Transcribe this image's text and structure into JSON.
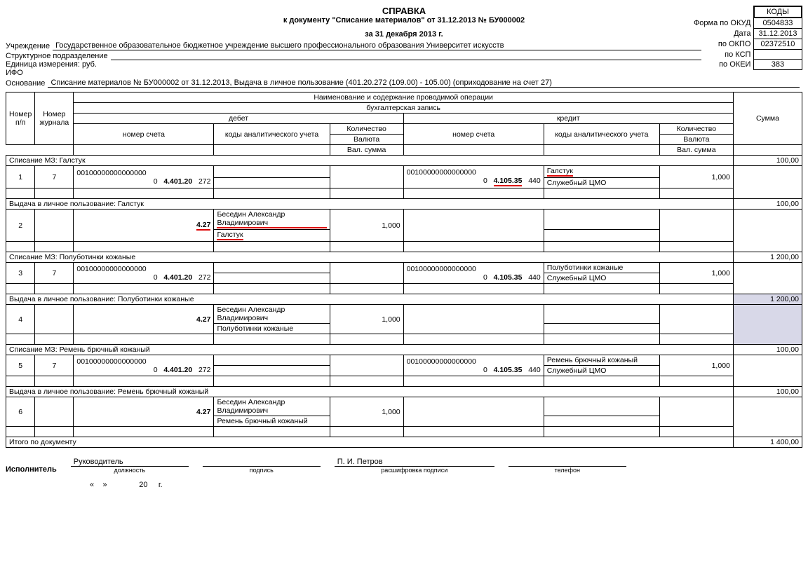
{
  "header": {
    "title": "СПРАВКА",
    "subtitle": "к документу \"Списание материалов\" от 31.12.2013 № БУ000002",
    "period": "за 31 декабря 2013 г."
  },
  "codes": {
    "hdr": "КОДЫ",
    "okud_lbl": "Форма  по ОКУД",
    "okud": "0504833",
    "date_lbl": "Дата",
    "date": "31.12.2013",
    "okpo_lbl": "по ОКПО",
    "okpo": "02372510",
    "ksp_lbl": "по КСП",
    "ksp": "",
    "okei_lbl": "по ОКЕИ",
    "okei": "383"
  },
  "org": {
    "inst_lbl": "Учреждение",
    "inst": "Государственное образовательное бюджетное учреждение высшего профессионального образования  Университет искусств",
    "dept_lbl": "Структурное подразделение",
    "dept": "",
    "unit_lbl": "Единица измерения: руб.",
    "ifo_lbl": "ИФО",
    "basis_lbl": "Основание",
    "basis": "Списание материалов № БУ000002 от 31.12.2013, Выдача в личное пользование (401.20.272 (109.00) - 105.00) (оприходование на счет 27)"
  },
  "th": {
    "np": "Номер п/п",
    "nj": "Номер журнала",
    "op": "Наименование и содержание проводимой операции",
    "be": "бухгалтерская запись",
    "deb": "дебет",
    "cre": "кредит",
    "acc": "номер счета",
    "code": "коды аналитического учета",
    "qty": "Количество",
    "cur": "Валюта",
    "vsum": "Вал. сумма",
    "sum": "Сумма"
  },
  "sections": [
    {
      "title": "Списание МЗ: Галстук",
      "sum": "100,00",
      "rows": [
        {
          "np": "1",
          "nj": "7",
          "deb_acc_top": "00100000000000000",
          "deb_acc_bot_0": "0",
          "deb_acc_bot_acc": "4.401.20",
          "deb_acc_bot_k": "272",
          "deb_code1": "",
          "deb_code2": "",
          "deb_qty": "",
          "cre_acc_top": "00100000000000000",
          "cre_acc_bot_0": "0",
          "cre_acc_bot_acc": "4.105.35",
          "cre_acc_bot_k": "440",
          "cre_code1": "Галстук",
          "cre_code2": "Служебный ЦМО",
          "cre_qty": "1,000",
          "underline_cre_acc": true,
          "underline_cre_code1": true
        }
      ]
    },
    {
      "title": "Выдача в личное пользование: Галстук",
      "sum": "100,00",
      "rows": [
        {
          "np": "2",
          "nj": "",
          "deb_acc_top": "",
          "deb_acc_bot_0": "",
          "deb_acc_bot_acc": "4.27",
          "deb_acc_bot_k": "",
          "deb_code1": "Беседин Александр Владимирович",
          "deb_code2": "Галстук",
          "deb_qty": "1,000",
          "cre_acc_top": "",
          "cre_acc_bot_0": "",
          "cre_acc_bot_acc": "",
          "cre_acc_bot_k": "",
          "cre_code1": "",
          "cre_code2": "",
          "cre_qty": "",
          "underline_deb_acc": true,
          "underline_deb_code1": true,
          "underline_deb_code2": true
        }
      ]
    },
    {
      "title": "Списание МЗ: Полуботинки кожаные",
      "sum": "1 200,00",
      "rows": [
        {
          "np": "3",
          "nj": "7",
          "deb_acc_top": "00100000000000000",
          "deb_acc_bot_0": "0",
          "deb_acc_bot_acc": "4.401.20",
          "deb_acc_bot_k": "272",
          "deb_code1": "",
          "deb_code2": "",
          "deb_qty": "",
          "cre_acc_top": "00100000000000000",
          "cre_acc_bot_0": "0",
          "cre_acc_bot_acc": "4.105.35",
          "cre_acc_bot_k": "440",
          "cre_code1": "Полуботинки кожаные",
          "cre_code2": "Служебный ЦМО",
          "cre_qty": "1,000"
        }
      ]
    },
    {
      "title": "Выдача в личное пользование: Полуботинки кожаные",
      "sum": "1 200,00",
      "shade": true,
      "rows": [
        {
          "np": "4",
          "nj": "",
          "deb_acc_top": "",
          "deb_acc_bot_0": "",
          "deb_acc_bot_acc": "4.27",
          "deb_acc_bot_k": "",
          "deb_code1": "Беседин Александр Владимирович",
          "deb_code2": "Полуботинки кожаные",
          "deb_qty": "1,000",
          "cre_acc_top": "",
          "cre_acc_bot_0": "",
          "cre_acc_bot_acc": "",
          "cre_acc_bot_k": "",
          "cre_code1": "",
          "cre_code2": "",
          "cre_qty": ""
        }
      ]
    },
    {
      "title": "Списание МЗ: Ремень брючный кожаный",
      "sum": "100,00",
      "rows": [
        {
          "np": "5",
          "nj": "7",
          "deb_acc_top": "00100000000000000",
          "deb_acc_bot_0": "0",
          "deb_acc_bot_acc": "4.401.20",
          "deb_acc_bot_k": "272",
          "deb_code1": "",
          "deb_code2": "",
          "deb_qty": "",
          "cre_acc_top": "00100000000000000",
          "cre_acc_bot_0": "0",
          "cre_acc_bot_acc": "4.105.35",
          "cre_acc_bot_k": "440",
          "cre_code1": "Ремень брючный кожаный",
          "cre_code2": "Служебный ЦМО",
          "cre_qty": "1,000"
        }
      ]
    },
    {
      "title": "Выдача в личное пользование: Ремень брючный кожаный",
      "sum": "100,00",
      "rows": [
        {
          "np": "6",
          "nj": "",
          "deb_acc_top": "",
          "deb_acc_bot_0": "",
          "deb_acc_bot_acc": "4.27",
          "deb_acc_bot_k": "",
          "deb_code1": "Беседин Александр Владимирович",
          "deb_code2": "Ремень брючный кожаный",
          "deb_qty": "1,000",
          "cre_acc_top": "",
          "cre_acc_bot_0": "",
          "cre_acc_bot_acc": "",
          "cre_acc_bot_k": "",
          "cre_code1": "",
          "cre_code2": "",
          "cre_qty": ""
        }
      ]
    }
  ],
  "total": {
    "label": "Итого по документу",
    "sum": "1 400,00"
  },
  "footer": {
    "exec_lbl": "Исполнитель",
    "pos": "Руководитель",
    "pos_cap": "должность",
    "sign_cap": "подпись",
    "name": "П. И. Петров",
    "name_cap": "расшифровка подписи",
    "phone_cap": "телефон",
    "date": "«___»_____________ 20___ г."
  }
}
